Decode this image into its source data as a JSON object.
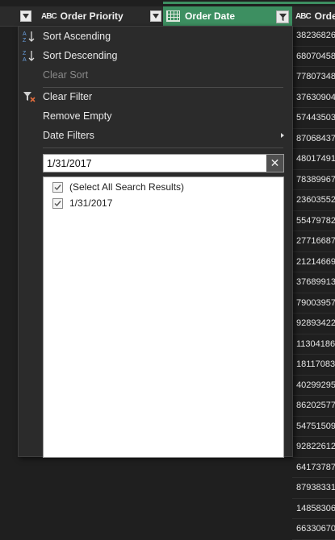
{
  "header": {
    "order_priority": {
      "type_badge": "ABC",
      "label": "Order Priority"
    },
    "order_date": {
      "label": "Order Date"
    },
    "right_col": {
      "type_badge": "ABC",
      "label": "Order"
    }
  },
  "menu": {
    "items": [
      {
        "label": "Sort Ascending",
        "icon": "sort-ascending-icon",
        "enabled": true
      },
      {
        "label": "Sort Descending",
        "icon": "sort-descending-icon",
        "enabled": true
      },
      {
        "label": "Clear Sort",
        "icon": "",
        "enabled": false
      },
      {
        "label": "Clear Filter",
        "icon": "clear-filter-icon",
        "enabled": true
      },
      {
        "label": "Remove Empty",
        "icon": "",
        "enabled": true
      },
      {
        "label": "Date Filters",
        "icon": "",
        "enabled": true,
        "submenu": true
      }
    ],
    "search": {
      "value": "1/31/2017",
      "clear_glyph": "✕"
    },
    "list": [
      {
        "label": "(Select All Search Results)",
        "checked": true
      },
      {
        "label": "1/31/2017",
        "checked": true
      }
    ]
  },
  "right_values": [
    "38236826",
    "68070458",
    "77807348",
    "37630904",
    "57443503",
    "87068437",
    "48017491",
    "78389967",
    "23603552",
    "55479782",
    "27716687",
    "21214669",
    "37689913",
    "79003957",
    "92893422",
    "11304186",
    "18117083",
    "40299295",
    "86202577",
    "54751509",
    "92822612",
    "64173787",
    "87938331",
    "14858306",
    "66330670"
  ],
  "colors": {
    "accent": "#3d8f61",
    "menu_bg": "#2b2b2b"
  }
}
